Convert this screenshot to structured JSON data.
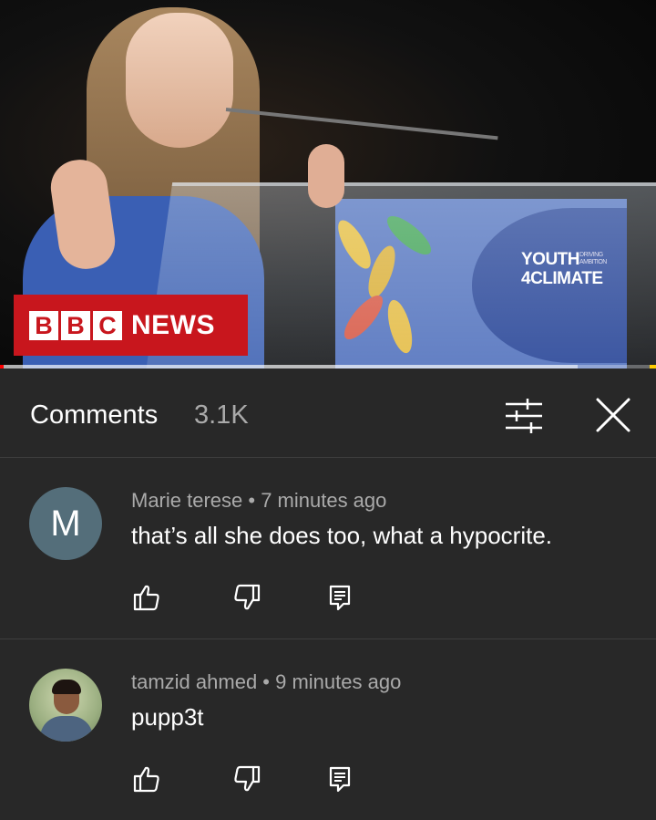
{
  "video": {
    "overlay_logo": "BBC NEWS",
    "bbc_letters": [
      "B",
      "B",
      "C"
    ],
    "news_label": "NEWS",
    "podium_logo_main": "YOUTH",
    "podium_logo_second": "4CLIMATE",
    "podium_logo_small": "DRIVING AMBITION",
    "progress_played_fraction": 0.006,
    "progress_buffered_fraction": 0.88
  },
  "comments_panel": {
    "title": "Comments",
    "count": "3.1K",
    "sort_icon": "sort-filter-icon",
    "close_icon": "close-icon"
  },
  "comments": [
    {
      "avatar_letter": "M",
      "avatar_color": "#546e7a",
      "author": "Marie terese",
      "time": "7 minutes ago",
      "meta": "Marie terese • 7 minutes ago",
      "text": "that’s all she does too, what a hypocrite."
    },
    {
      "avatar_letter": "",
      "author": "tamzid ahmed",
      "time": "9 minutes ago",
      "meta": "tamzid ahmed • 9 minutes ago",
      "text": "pupp3t"
    }
  ],
  "colors": {
    "background": "#282828",
    "bbc_red": "#c8161d",
    "secondary_text": "#aaaaaa",
    "progress_red": "#ff0000"
  }
}
